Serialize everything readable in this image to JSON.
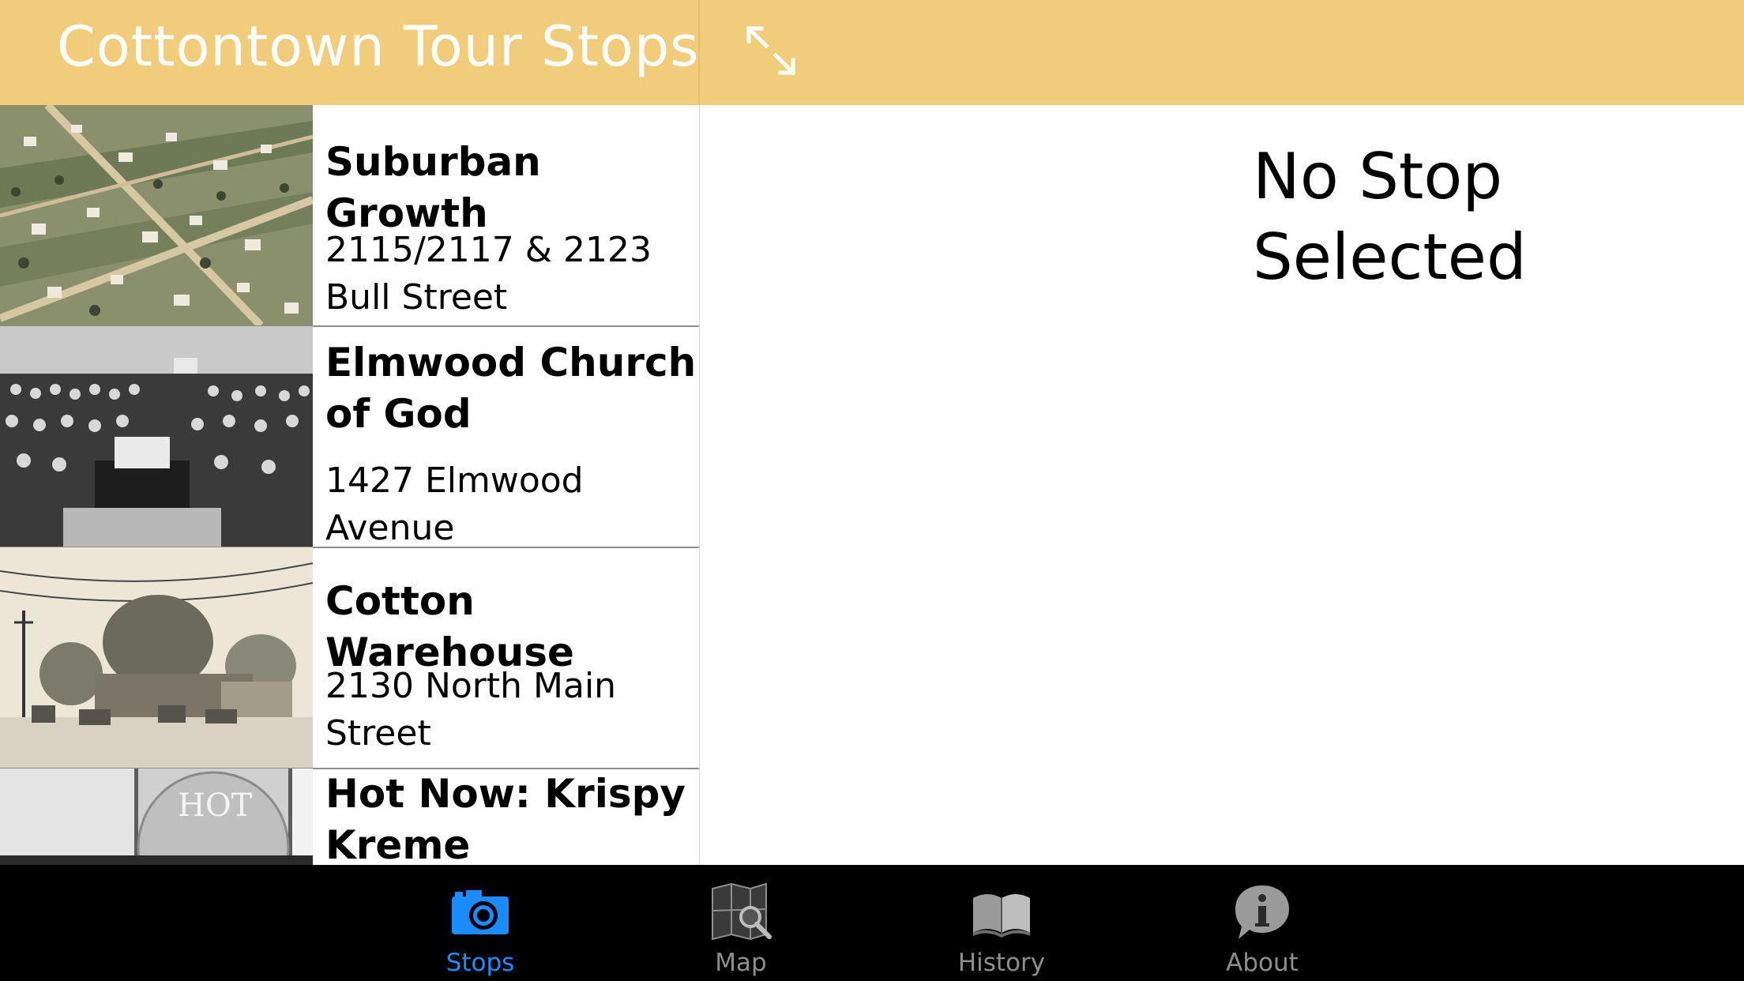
{
  "header": {
    "title": "Cottontown Tour Stops",
    "background": "#f1cc7a"
  },
  "stops": [
    {
      "title": "Suburban Growth",
      "address": "2115/2117 & 2123 Bull Street",
      "thumbnail": "aerial-town-illustration"
    },
    {
      "title": "Elmwood Church of God",
      "address": "1427 Elmwood Avenue",
      "thumbnail": "church-congregation-photo"
    },
    {
      "title": "Cotton Warehouse",
      "address": "2130 North Main Street",
      "thumbnail": "street-scene-photo"
    },
    {
      "title": "Hot Now: Krispy Kreme",
      "address": "",
      "thumbnail": "hot-now-sign-photo"
    }
  ],
  "detail": {
    "empty_message": "No Stop Selected"
  },
  "tabs": [
    {
      "label": "Stops",
      "icon": "camera-icon",
      "active": true
    },
    {
      "label": "Map",
      "icon": "map-search-icon",
      "active": false
    },
    {
      "label": "History",
      "icon": "book-icon",
      "active": false
    },
    {
      "label": "About",
      "icon": "info-icon",
      "active": false
    }
  ],
  "colors": {
    "active_tab": "#1a8cff",
    "inactive_tab": "#8e8e8e",
    "tabbar_bg": "#000000"
  }
}
